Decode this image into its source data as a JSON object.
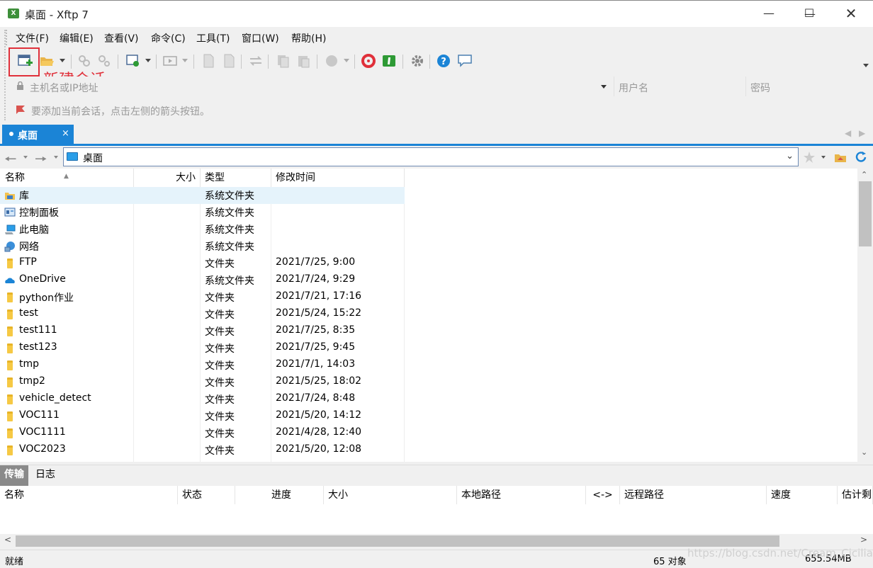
{
  "window": {
    "title": "桌面 - Xftp 7",
    "app_icon": "xftp-app-icon"
  },
  "menu": [
    "文件(F)",
    "编辑(E)",
    "查看(V)",
    "命令(C)",
    "工具(T)",
    "窗口(W)",
    "帮助(H)"
  ],
  "annotation": {
    "label": "新建会话",
    "color": "#e0303a"
  },
  "address": {
    "host_placeholder": "主机名或IP地址",
    "user_placeholder": "用户名",
    "pass_placeholder": "密码"
  },
  "hint": "要添加当前会话，点击左侧的箭头按钮。",
  "tab": {
    "label": "桌面",
    "close": "×"
  },
  "path": {
    "current": "桌面"
  },
  "columns": {
    "name": "名称",
    "size": "大小",
    "type": "类型",
    "mtime": "修改时间"
  },
  "files": [
    {
      "name": "库",
      "type": "系统文件夹",
      "mtime": "",
      "icon": "library-icon"
    },
    {
      "name": "控制面板",
      "type": "系统文件夹",
      "mtime": "",
      "icon": "control-panel-icon"
    },
    {
      "name": "此电脑",
      "type": "系统文件夹",
      "mtime": "",
      "icon": "computer-icon"
    },
    {
      "name": "网络",
      "type": "系统文件夹",
      "mtime": "",
      "icon": "network-icon"
    },
    {
      "name": "FTP",
      "type": "文件夹",
      "mtime": "2021/7/25, 9:00",
      "icon": "folder-icon"
    },
    {
      "name": "OneDrive",
      "type": "系统文件夹",
      "mtime": "2021/7/24, 9:29",
      "icon": "onedrive-icon"
    },
    {
      "name": "python作业",
      "type": "文件夹",
      "mtime": "2021/7/21, 17:16",
      "icon": "folder-icon"
    },
    {
      "name": "test",
      "type": "文件夹",
      "mtime": "2021/5/24, 15:22",
      "icon": "folder-icon"
    },
    {
      "name": "test111",
      "type": "文件夹",
      "mtime": "2021/7/25, 8:35",
      "icon": "folder-icon"
    },
    {
      "name": "test123",
      "type": "文件夹",
      "mtime": "2021/7/25, 9:45",
      "icon": "folder-icon"
    },
    {
      "name": "tmp",
      "type": "文件夹",
      "mtime": "2021/7/1, 14:03",
      "icon": "folder-icon"
    },
    {
      "name": "tmp2",
      "type": "文件夹",
      "mtime": "2021/5/25, 18:02",
      "icon": "folder-icon"
    },
    {
      "name": "vehicle_detect",
      "type": "文件夹",
      "mtime": "2021/7/24, 8:48",
      "icon": "folder-icon"
    },
    {
      "name": "VOC111",
      "type": "文件夹",
      "mtime": "2021/5/20, 14:12",
      "icon": "folder-icon"
    },
    {
      "name": "VOC1111",
      "type": "文件夹",
      "mtime": "2021/4/28, 12:40",
      "icon": "folder-icon"
    },
    {
      "name": "VOC2023",
      "type": "文件夹",
      "mtime": "2021/5/20, 12:08",
      "icon": "folder-icon"
    }
  ],
  "transfer_tabs": [
    "传输",
    "日志"
  ],
  "transfer_columns": [
    "名称",
    "状态",
    "进度",
    "大小",
    "本地路径",
    "<->",
    "远程路径",
    "速度",
    "估计剩"
  ],
  "status": {
    "left": "就绪",
    "objects": "65 对象",
    "size": "655.54MB"
  },
  "watermark": "https://blog.csdn.net/Cream_Cicilian",
  "colors": {
    "accent": "#1b84d6",
    "selected_row": "#e5f3fb"
  }
}
